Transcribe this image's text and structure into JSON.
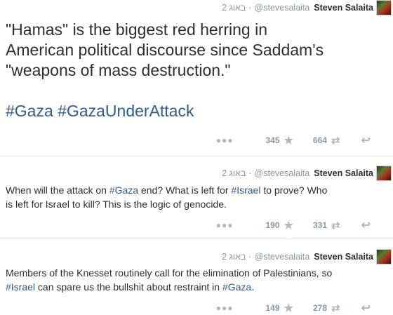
{
  "tweets": [
    {
      "time": "2 באוג",
      "handle": "@stevesalaita",
      "name": "Steven Salaita",
      "text_lines": [
        [
          {
            "t": "\"Hamas\" is the biggest red herring in"
          }
        ],
        [
          {
            "t": "American political discourse since Saddam's"
          }
        ],
        [
          {
            "t": "\"weapons of mass destruction.\""
          }
        ],
        [
          {
            "t": " "
          }
        ],
        [
          {
            "t": "#Gaza",
            "tag": true
          },
          {
            "t": " "
          },
          {
            "t": "#GazaUnderAttack",
            "tag": true
          }
        ]
      ],
      "favorites": "345",
      "retweets": "664"
    },
    {
      "time": "2 באוג",
      "handle": "@stevesalaita",
      "name": "Steven Salaita",
      "text_lines": [
        [
          {
            "t": "When will the attack on "
          },
          {
            "t": "#Gaza",
            "tag": true
          },
          {
            "t": " end?  What is left for "
          },
          {
            "t": "#Israel",
            "tag": true
          },
          {
            "t": " to prove?  Who"
          }
        ],
        [
          {
            "t": "is left for Israel to kill?  This is the logic of genocide."
          }
        ]
      ],
      "favorites": "190",
      "retweets": "331"
    },
    {
      "time": "2 באוג",
      "handle": "@stevesalaita",
      "name": "Steven Salaita",
      "text_lines": [
        [
          {
            "t": "Members of the Knesset routinely call for the elimination of Palestinians, so"
          }
        ],
        [
          {
            "t": "#Israel",
            "tag": true
          },
          {
            "t": " can spare us the bullshit about restraint in "
          },
          {
            "t": "#Gaza",
            "tag": true
          },
          {
            "t": "."
          }
        ]
      ],
      "favorites": "149",
      "retweets": "278"
    }
  ],
  "icons": {
    "more": "more-dots-icon",
    "favorite": "star-icon",
    "retweet": "retweet-icon",
    "reply": "reply-icon"
  },
  "colors": {
    "hashtag": "#2b5c94",
    "meta": "#8899a6",
    "icon": "#aab8c2",
    "divider": "#e1e8ed"
  }
}
